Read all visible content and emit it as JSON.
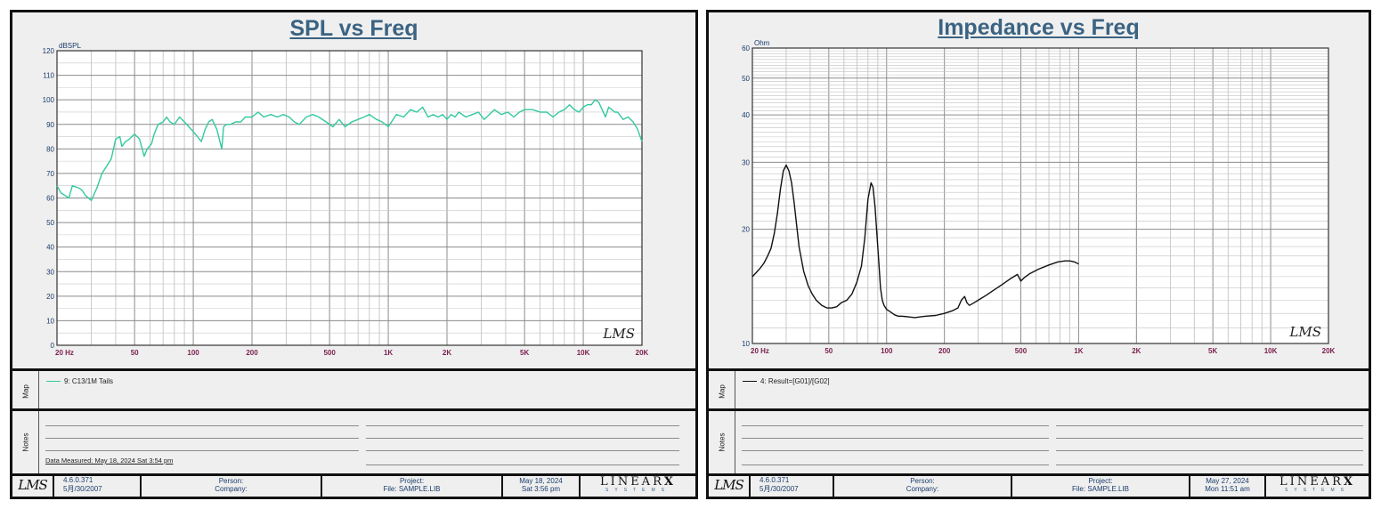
{
  "colors": {
    "spl_line": "#33c9a0",
    "impedance_line": "#111111",
    "title": "#3b6382",
    "tick": "#7a1f4d",
    "footer_text": "#1a3c6b"
  },
  "watermark": "LMS",
  "left": {
    "title": "SPL vs Freq",
    "legend": "9: C13/1M Tails",
    "map_label": "Map",
    "notes_label": "Notes",
    "measured": "Data Measured: May 18, 2024  Sat  3:54 pm",
    "footer": {
      "logo": "LMS",
      "version": "4.6.0.371",
      "build": "5月/30/2007",
      "person": "Person:",
      "company": "Company:",
      "project": "Project:",
      "file": "File: SAMPLE.LIB",
      "date": "May 18, 2024",
      "time": "Sat  3:56 pm",
      "brand": "LINEAR",
      "brand_x": "X",
      "brand_sub": "SYSTEMS"
    }
  },
  "right": {
    "title": "Impedance vs Freq",
    "legend": "4: Result=[G01]/[G02]",
    "map_label": "Map",
    "notes_label": "Notes",
    "footer": {
      "logo": "LMS",
      "version": "4.6.0.371",
      "build": "5月/30/2007",
      "person": "Person:",
      "company": "Company:",
      "project": "Project:",
      "file": "File: SAMPLE.LIB",
      "date": "May 27, 2024",
      "time": "Mon 11:51 am",
      "brand": "LINEAR",
      "brand_x": "X",
      "brand_sub": "SYSTEMS"
    }
  },
  "chart_data": [
    {
      "type": "line",
      "title": "SPL vs Freq",
      "ylabel": "dBSPL",
      "xscale": "log",
      "xlim": [
        20,
        20000
      ],
      "ylim": [
        0,
        120
      ],
      "x_ticks": [
        20,
        50,
        100,
        200,
        500,
        1000,
        2000,
        5000,
        10000,
        20000
      ],
      "x_tick_labels": [
        "20  Hz",
        "50",
        "100",
        "200",
        "500",
        "1K",
        "2K",
        "5K",
        "10K",
        "20K"
      ],
      "y_ticks": [
        0,
        10,
        20,
        30,
        40,
        50,
        60,
        70,
        80,
        90,
        100,
        110,
        120
      ],
      "grid": true,
      "series": [
        {
          "name": "9: C13/1M Tails",
          "x": [
            20,
            21,
            22,
            23,
            24,
            26,
            27,
            28,
            30,
            32,
            33,
            34,
            36,
            38,
            40,
            42,
            43,
            45,
            47,
            50,
            53,
            56,
            58,
            61,
            63,
            66,
            70,
            73,
            76,
            80,
            85,
            90,
            95,
            100,
            105,
            110,
            115,
            120,
            125,
            132,
            140,
            143,
            148,
            155,
            165,
            175,
            185,
            200,
            215,
            230,
            250,
            270,
            290,
            310,
            330,
            350,
            380,
            410,
            440,
            480,
            520,
            560,
            600,
            650,
            700,
            750,
            800,
            870,
            930,
            1000,
            1100,
            1200,
            1300,
            1400,
            1500,
            1600,
            1700,
            1800,
            1900,
            2000,
            2100,
            2200,
            2300,
            2500,
            2700,
            2900,
            3100,
            3300,
            3500,
            3800,
            4100,
            4400,
            4700,
            5000,
            5500,
            6000,
            6500,
            7000,
            7500,
            8000,
            8500,
            9000,
            9500,
            10000,
            10500,
            11000,
            11500,
            12000,
            12500,
            13000,
            13500,
            14000,
            14500,
            15000,
            16000,
            17000,
            18000,
            19000,
            20000
          ],
          "values": [
            65,
            62,
            61,
            60,
            65,
            64,
            63,
            61,
            59,
            64,
            67,
            70,
            73,
            76,
            84,
            85,
            81,
            83,
            84,
            86,
            84,
            77,
            80,
            82,
            86,
            90,
            91,
            93,
            91,
            90,
            93,
            91,
            89,
            87,
            85,
            83,
            88,
            91,
            92,
            88,
            80,
            89,
            90,
            90,
            91,
            91,
            93,
            93,
            95,
            93,
            94,
            93,
            94,
            93,
            91,
            90,
            93,
            94,
            93,
            91,
            89,
            92,
            89,
            91,
            92,
            93,
            94,
            92,
            91,
            89,
            94,
            93,
            96,
            95,
            97,
            93,
            94,
            93,
            94,
            92,
            94,
            93,
            95,
            93,
            94,
            95,
            92,
            94,
            96,
            94,
            95,
            93,
            95,
            96,
            96,
            95,
            95,
            93,
            95,
            96,
            98,
            96,
            95,
            97,
            98,
            98,
            100,
            99,
            96,
            93,
            97,
            96,
            95,
            95,
            92,
            93,
            91,
            88,
            83
          ]
        }
      ]
    },
    {
      "type": "line",
      "title": "Impedance vs Freq",
      "ylabel": "Ohm",
      "xscale": "log",
      "yscale": "log",
      "xlim": [
        20,
        20000
      ],
      "ylim": [
        10,
        60
      ],
      "x_ticks": [
        20,
        50,
        100,
        200,
        500,
        1000,
        2000,
        5000,
        10000,
        20000
      ],
      "x_tick_labels": [
        "20  Hz",
        "50",
        "100",
        "200",
        "500",
        "1K",
        "2K",
        "5K",
        "10K",
        "20K"
      ],
      "y_ticks": [
        10,
        20,
        30,
        40,
        50,
        60
      ],
      "grid": true,
      "series": [
        {
          "name": "4: Result=[G01]/[G02]",
          "x": [
            20,
            21,
            22,
            23,
            24,
            25,
            26,
            27,
            28,
            29,
            30,
            31,
            32,
            33,
            34,
            35,
            37,
            39,
            41,
            43,
            46,
            49,
            52,
            55,
            58,
            62,
            66,
            70,
            74,
            77,
            80,
            83,
            85,
            87,
            89,
            91,
            93,
            95,
            97,
            100,
            105,
            110,
            115,
            120,
            130,
            140,
            150,
            160,
            180,
            200,
            220,
            235,
            245,
            255,
            262,
            270,
            285,
            300,
            330,
            360,
            400,
            440,
            480,
            500,
            520,
            560,
            620,
            700,
            780,
            850,
            900,
            950,
            1000
          ],
          "values": [
            15.0,
            15.4,
            15.8,
            16.3,
            17.0,
            17.8,
            19.5,
            22.0,
            25.5,
            28.5,
            29.5,
            28.5,
            26.5,
            23.5,
            20.5,
            18.0,
            15.5,
            14.2,
            13.5,
            13.0,
            12.6,
            12.4,
            12.4,
            12.5,
            12.8,
            13.0,
            13.5,
            14.5,
            16.0,
            19.0,
            24.0,
            26.5,
            25.8,
            23.0,
            19.5,
            16.5,
            14.0,
            13.0,
            12.6,
            12.3,
            12.1,
            11.9,
            11.8,
            11.8,
            11.75,
            11.7,
            11.75,
            11.8,
            11.85,
            12.0,
            12.2,
            12.4,
            13.0,
            13.3,
            12.8,
            12.6,
            12.8,
            13.0,
            13.4,
            13.8,
            14.3,
            14.8,
            15.2,
            14.6,
            14.9,
            15.3,
            15.7,
            16.1,
            16.4,
            16.5,
            16.5,
            16.4,
            16.2
          ]
        }
      ]
    }
  ]
}
